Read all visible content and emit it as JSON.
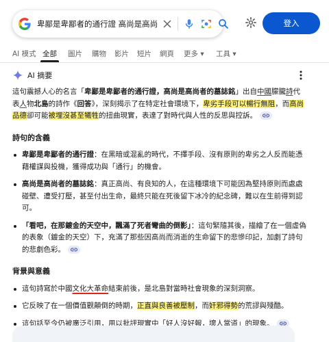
{
  "search": {
    "query": "卑鄙是卑鄙者的通行證 高尚是高尚"
  },
  "header": {
    "login_label": "登入"
  },
  "tabs": [
    {
      "label": "AI 模式"
    },
    {
      "label": "全部"
    },
    {
      "label": "圖片"
    },
    {
      "label": "購物"
    },
    {
      "label": "影片"
    },
    {
      "label": "短片"
    },
    {
      "label": "網頁"
    },
    {
      "label": "更多 ▾"
    },
    {
      "label": "工具 ▾"
    }
  ],
  "ai_overview": {
    "title": "AI 摘要",
    "intro": {
      "p1": "這句震撼人心的名言「",
      "quote": "卑鄙是卑鄙者的通行證，高尚是高尚者的墓誌銘",
      "p2": "」出自",
      "china": "中國",
      "p3": "朦朧",
      "poet": "詩",
      "p4": "代表",
      "person": "人",
      "p5": "物",
      "beidao": "北島",
      "p6": "的詩作《",
      "poem": "回答",
      "p7": "》，深刻揭示了在特定社會環境下，",
      "hl1": "卑劣手段可以暢行無阻",
      "p8": "，而",
      "hl2": "高尚品德",
      "p9": "卻可能",
      "hl3": "被埋沒甚至犧牲",
      "p10": "的扭曲現實，表達了對時代與人性的反思與控訴。"
    },
    "section1": {
      "heading": "詩句的含義",
      "items": [
        {
          "bold": "卑鄙是卑鄙者的通行證",
          "text": "：在黑暗或混亂的時代，不擇手段、沒有原則的卑劣之人反而能憑藉權謀與投機，獲得成功與「通行」的機會。"
        },
        {
          "bold": "高尚是高尚者的墓誌銘",
          "text": "：真正高尚、有良知的人，在這種環境下可能因為堅持原則而處處碰壁、遭受打壓，甚至付出生命，最終只能在死後留下冰冷的紀念碑，難以在生前得到認可。"
        },
        {
          "bold": "「看吧，在那鍍金的天空中，飄滿了死者彎曲的倒影」",
          "text": "：這句緊隨其後，描繪了在一個虛偽的表象（鍍金的天空）下，充滿了那些因高尚而消逝的生命留下的悲慘印記，加劇了詩句的悲劇色彩。"
        }
      ]
    },
    "section2": {
      "heading": "背景與意義",
      "items": [
        {
          "p1": "這句詩寫於中國",
          "red": "文化大革命",
          "p2": "結束前後，是北島對當時社會現象的深刻洞察。"
        },
        {
          "p1": "它反映了在一個價值觀顛倒的時期，",
          "hl1": "正直與良善被壓制",
          "p2": "，而",
          "hl2": "奸邪得勢",
          "p3": "的荒謬與殘酷。"
        },
        {
          "p1": "這句話至今仍被廣泛引用，用以批評現實中「好人沒好報，壞人當道」的現象。"
        }
      ]
    }
  },
  "colors": {
    "accent": "#0b57d0",
    "highlight": "#fff27a",
    "red_underline": "#e0241a"
  }
}
